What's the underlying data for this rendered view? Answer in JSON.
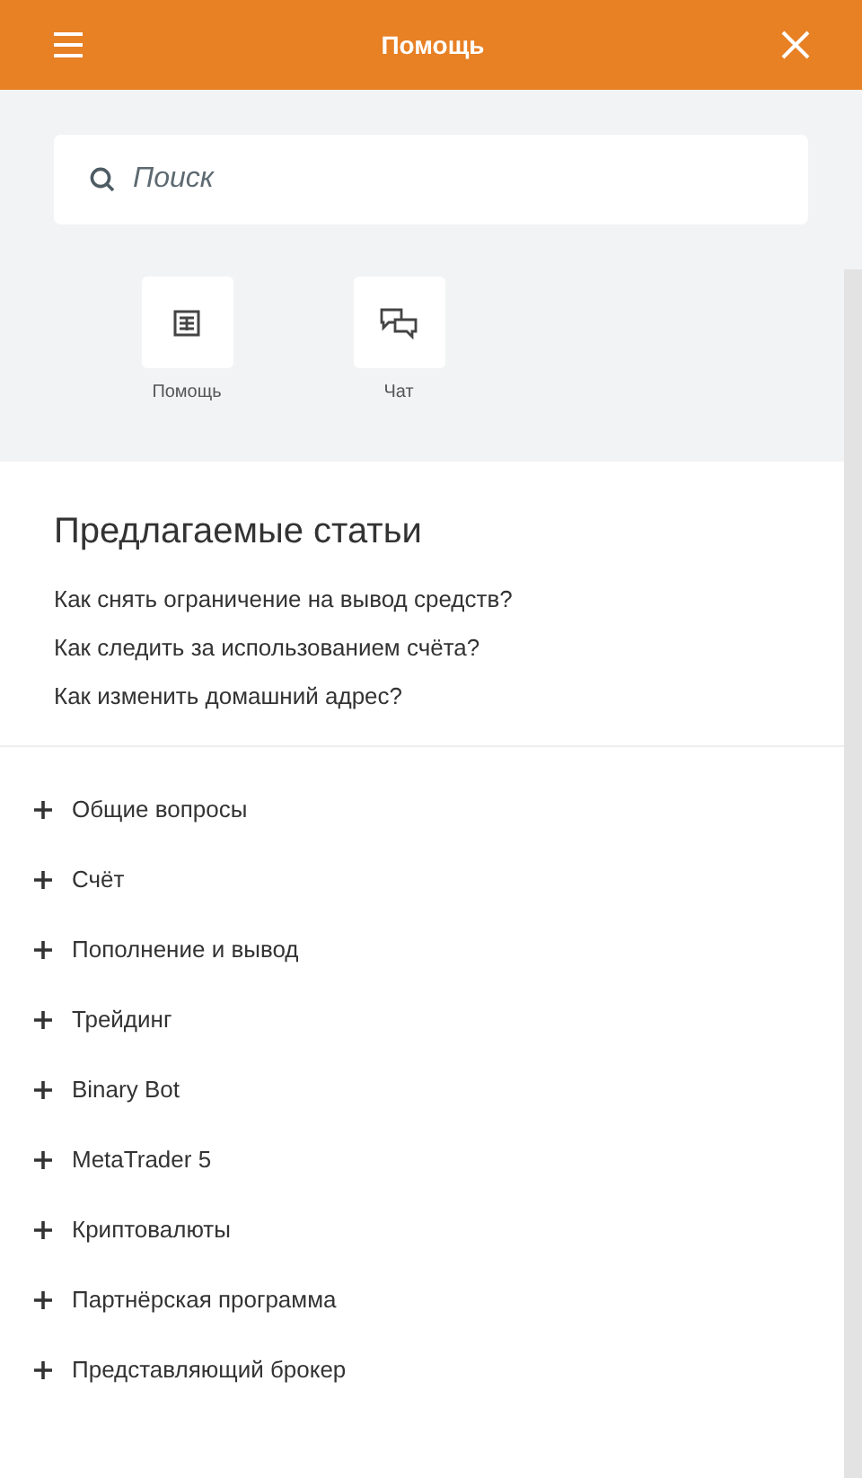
{
  "header": {
    "title": "Помощь"
  },
  "search": {
    "placeholder": "Поиск"
  },
  "shortcuts": [
    {
      "kind": "help",
      "label": "Помощь"
    },
    {
      "kind": "chat",
      "label": "Чат"
    }
  ],
  "suggested": {
    "title": "Предлагаемые статьи",
    "articles": [
      "Как снять ограничение на вывод средств?",
      "Как следить за использованием счёта?",
      "Как изменить домашний адрес?"
    ]
  },
  "categories": [
    {
      "label": "Общие вопросы",
      "expanded": false
    },
    {
      "label": "Счёт",
      "expanded": false
    },
    {
      "label": "Пополнение и вывод",
      "expanded": false
    },
    {
      "label": "Трейдинг",
      "expanded": false
    },
    {
      "label": "Binary Bot",
      "expanded": false
    },
    {
      "label": "MetaTrader 5",
      "expanded": false
    },
    {
      "label": "Криптовалюты",
      "expanded": false
    },
    {
      "label": "Партнёрская программа",
      "expanded": false
    },
    {
      "label": "Представляющий брокер",
      "expanded": false
    }
  ]
}
